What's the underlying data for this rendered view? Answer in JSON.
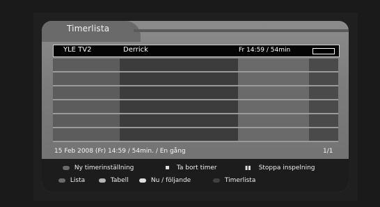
{
  "window": {
    "title": "Timerlista"
  },
  "timer_list": {
    "first_row": {
      "channel": "YLE TV2",
      "program": "Derrick",
      "time": "Fr 14:59 / 54min"
    },
    "empty_rows": 6
  },
  "status": {
    "detail": "15 Feb 2008 (Fr) 14:59 / 54min. / En gång",
    "page": "1/1"
  },
  "footer": {
    "new_timer": "Ny timerinställning",
    "delete_timer": "Ta bort timer",
    "stop_recording": "Stoppa inspelning",
    "list": "Lista",
    "table": "Tabell",
    "now_next": "Nu / följande",
    "timer_list": "Timerlista",
    "colors": {
      "red": "#6a6a6a",
      "green": "#b5b5b5",
      "yellow": "#e0e0e0",
      "blue": "#3f3f3f"
    }
  }
}
